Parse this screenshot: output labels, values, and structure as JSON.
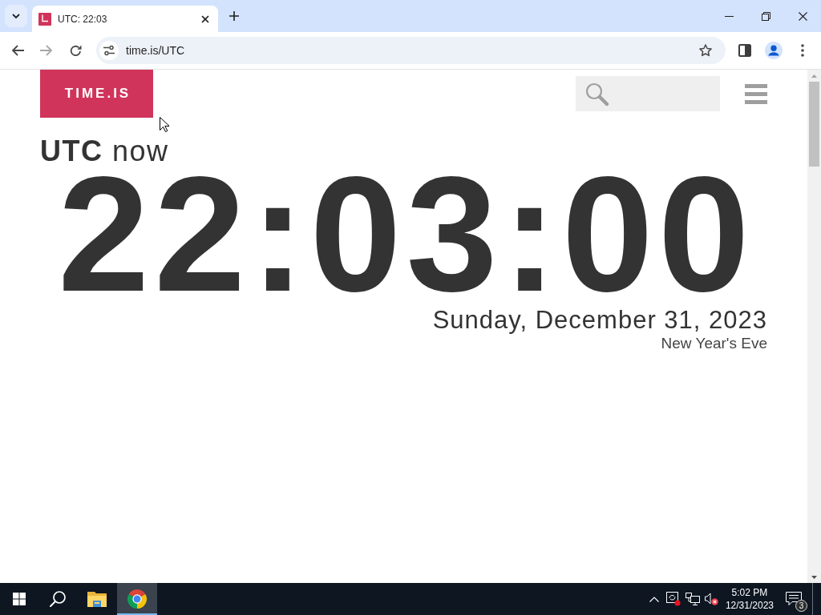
{
  "browser": {
    "tabs": [
      {
        "title": "UTC: 22:03",
        "selected": true
      }
    ],
    "forward_disabled": true,
    "address": "time.is/UTC"
  },
  "page": {
    "logo": "TIME.IS",
    "heading": "**UTC** now",
    "clock": "22:03:00",
    "date": "Sunday, December 31, 2023",
    "holiday": "New Year's Eve"
  },
  "taskbar": {
    "apps": [
      {
        "kind": "explorer",
        "selected": false
      },
      {
        "kind": "chrome",
        "selected": true
      }
    ],
    "volume_muted": true,
    "clock": {
      "time": "5:02 PM",
      "date": "12/31/2023"
    },
    "notifications": "3"
  }
}
